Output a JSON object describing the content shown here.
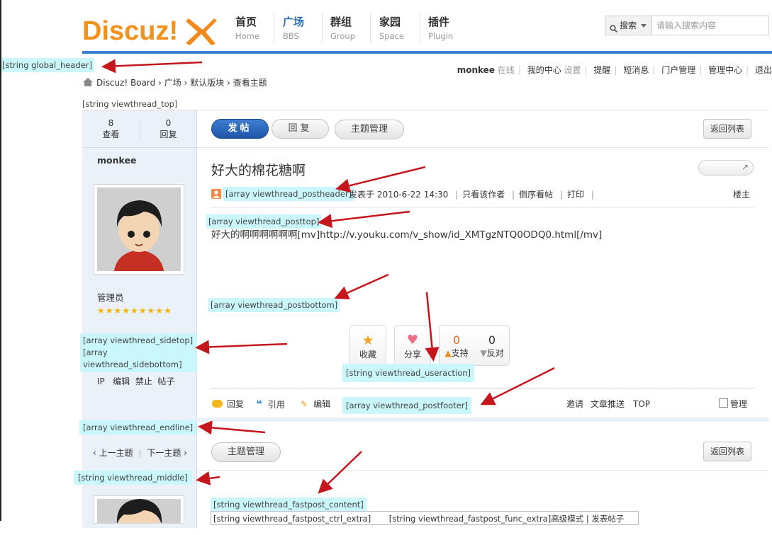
{
  "header": {
    "logo_text": "Discuz!",
    "nav": [
      {
        "zh": "首页",
        "en": "Home"
      },
      {
        "zh": "广场",
        "en": "BBS"
      },
      {
        "zh": "群组",
        "en": "Group"
      },
      {
        "zh": "家园",
        "en": "Space"
      },
      {
        "zh": "插件",
        "en": "Plugin"
      }
    ],
    "search_type": "搜索",
    "search_placeholder": "请输入搜索内容"
  },
  "userbar": {
    "username": "monkee",
    "status": "在线",
    "my_center": "我的中心",
    "settings": "设置",
    "notify": "提醒",
    "messages": "短消息",
    "portal_admin": "门户管理",
    "admin_center": "管理中心",
    "logout": "退出"
  },
  "hooks": {
    "global_header": "[string global_header]",
    "viewthread_top": "[string viewthread_top]",
    "postheader": "[array viewthread_postheader]",
    "posttop": "[array viewthread_posttop]",
    "postbottom": "[array viewthread_postbottom]",
    "sidetop": "[array viewthread_sidetop][array viewthread_sidebottom]",
    "useraction": "[string viewthread_useraction]",
    "postfooter": "[array viewthread_postfooter]",
    "endline": "[array viewthread_endline]",
    "middle": "[string viewthread_middle]",
    "fastpost_content": "[string viewthread_fastpost_content]",
    "fastpost_bottom": "[string viewthread_fastpost_ctrl_extra]       [string viewthread_fastpost_func_extra]高级模式 | 发表帖子"
  },
  "breadcrumb": {
    "board": "Discuz! Board",
    "sep": "›",
    "forum": "广场",
    "block": "默认版块",
    "current": "查看主题"
  },
  "stats": {
    "views": "8",
    "views_label": "查看",
    "replies": "0",
    "replies_label": "回复"
  },
  "author": {
    "name": "monkee",
    "group": "管理员",
    "links": [
      "IP",
      "编辑",
      "禁止",
      "帖子"
    ]
  },
  "toolbar": {
    "new_post": "发帖",
    "reply": "回复",
    "manage": "主题管理",
    "back": "返回列表"
  },
  "post": {
    "title": "好大的棉花糖啊",
    "posted_at": "发表于 2010-6-22 14:30",
    "only_author": "只看该作者",
    "reverse": "倒序看帖",
    "print": "打印",
    "floor": "楼主",
    "content": "好大的啊啊啊啊啊啊[mv]http://v.youku.com/v_show/id_XMTgzNTQ0ODQ0.html[/mv]"
  },
  "actions": {
    "favorite": "收藏",
    "share": "分享",
    "support_count": "0",
    "support": "支持",
    "oppose_count": "0",
    "oppose": "反对"
  },
  "footer_links": {
    "reply": "回复",
    "quote": "引用",
    "edit": "编辑",
    "invite": "邀请",
    "push": "文章推送",
    "top": "TOP",
    "manage": "管理"
  },
  "pager": {
    "prev": "‹ 上一主题",
    "next": "下一主题 ›"
  },
  "colors": {
    "accent": "#2b6eb5",
    "highlight": "#c9f7fb",
    "arrow": "#c4161c"
  }
}
